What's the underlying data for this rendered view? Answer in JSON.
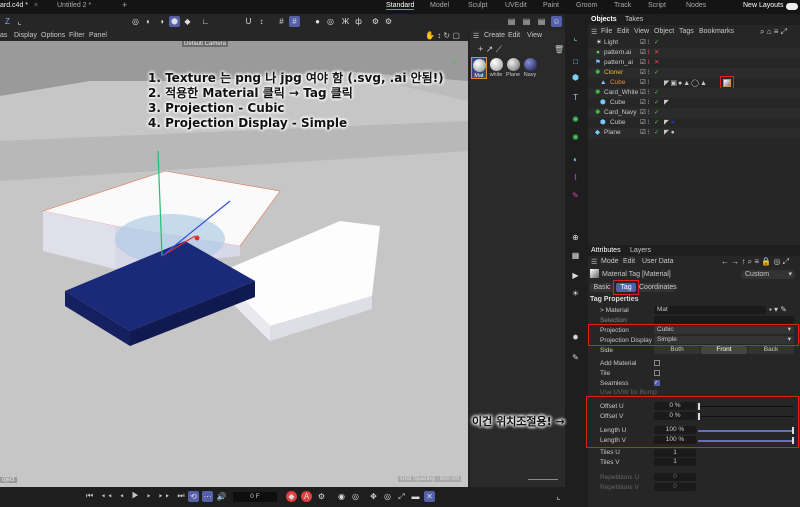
{
  "tabs": {
    "files": [
      "ard.c4d *",
      "Untitled 2 *"
    ],
    "add": "+",
    "layouts": [
      "Standard",
      "Model",
      "Sculpt",
      "UVEdit",
      "Paint",
      "Groom",
      "Track",
      "Script",
      "Nodes"
    ],
    "new_layouts": "New Layouts"
  },
  "viewport": {
    "menu": [
      "as",
      "Display",
      "Options",
      "Filter",
      "Panel"
    ],
    "camera": "Default Camera",
    "grid": "Grid Spacing : 500 cm",
    "corner": "oject"
  },
  "notes": [
    "1. Texture 는 png 나 jpg 여야 함 (.svg, .ai 안됨!)",
    "2. 적용한 Material 클릭 → Tag 클릭",
    "3. Projection - Cubic",
    "4. Projection Display - Simple"
  ],
  "side_note": "이건 위치조절용! →",
  "materials": {
    "menu": [
      "Create",
      "Edit",
      "View"
    ],
    "items": [
      "Mat",
      "white",
      "Plane",
      "Navy"
    ]
  },
  "objects": {
    "tabs": [
      "Objects",
      "Takes"
    ],
    "menu": [
      "File",
      "Edit",
      "View",
      "Object",
      "Tags",
      "Bookmarks"
    ],
    "rows": [
      {
        "name": "Light",
        "check": "✓"
      },
      {
        "name": "pattern.ai",
        "check": "✕"
      },
      {
        "name": "pattern_ai",
        "check": "✕"
      },
      {
        "name": "Cloner",
        "check": "✓"
      },
      {
        "name": "Cube",
        "check": ""
      },
      {
        "name": "Card_White",
        "check": "✓"
      },
      {
        "name": "Cube",
        "check": "✓"
      },
      {
        "name": "Card_Navy",
        "check": "✓"
      },
      {
        "name": "Cube",
        "check": "✓"
      },
      {
        "name": "Plane",
        "check": "✓"
      }
    ]
  },
  "attributes": {
    "tabs": [
      "Attributes",
      "Layers"
    ],
    "menu": [
      "Mode",
      "Edit",
      "User Data"
    ],
    "title": "Material Tag [Material]",
    "preset": "Custom",
    "subtabs": [
      "Basic",
      "Tag",
      "Coordinates"
    ],
    "section": "Tag Properties",
    "material_label": "> Material",
    "material": "Mat",
    "selection": "Selection",
    "projection_label": "Projection",
    "projection": "Cubic",
    "display_label": "Projection Display",
    "display": "Simple",
    "side_label": "Side",
    "side": [
      "Both",
      "Front",
      "Back"
    ],
    "add_material": "Add Material",
    "tile": "Tile",
    "seamless": "Seamless",
    "use_uvw": "Use UVW for Bump",
    "offset_u_label": "Offset U",
    "offset_u": "0 %",
    "offset_v_label": "Offset V",
    "offset_v": "0 %",
    "length_u_label": "Length U",
    "length_u": "100 %",
    "length_v_label": "Length V",
    "length_v": "100 %",
    "tiles_u_label": "Tiles U",
    "tiles_u": "1",
    "tiles_v_label": "Tiles V",
    "tiles_v": "1",
    "rep_u_label": "Repetitions U",
    "rep_u": "0",
    "rep_v_label": "Repetitions V",
    "rep_v": "0"
  },
  "timeline": {
    "frame": "0 F"
  }
}
